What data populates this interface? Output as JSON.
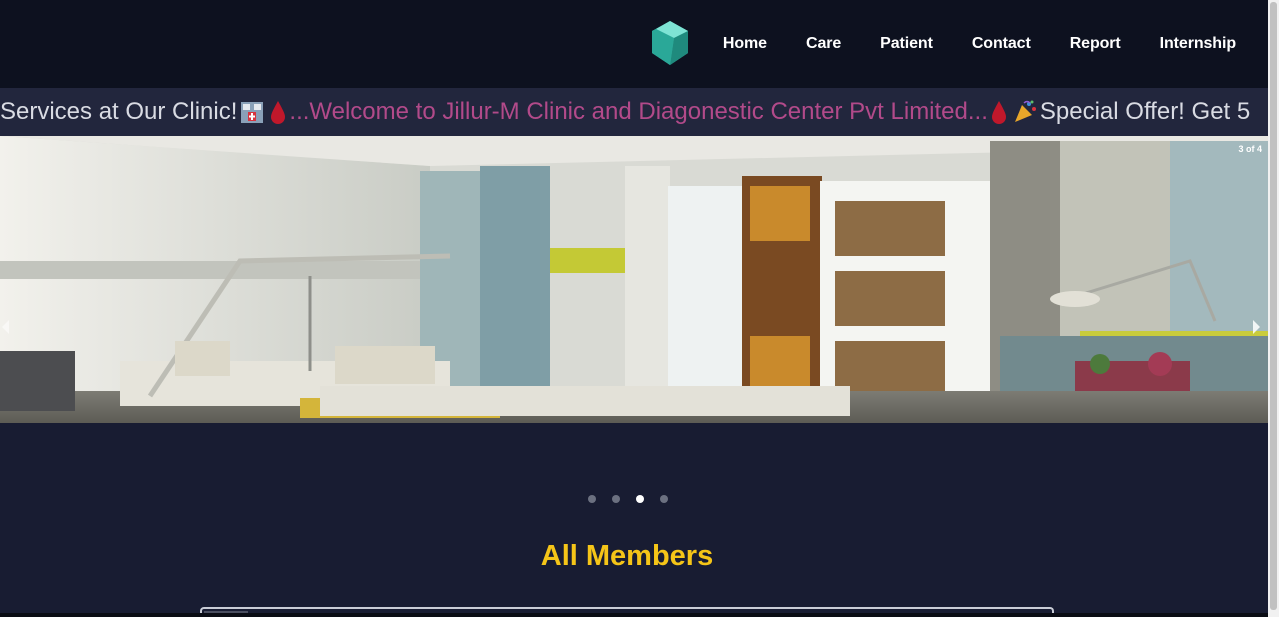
{
  "nav": {
    "logo": "gem-logo-icon",
    "links": [
      "Home",
      "Care",
      "Patient",
      "Contact",
      "Report",
      "Internship"
    ]
  },
  "marquee": {
    "part1": "Services at Our Clinic! ",
    "part2": "...Welcome to Jillur-M Clinic and Diagonestic Center Pvt Limited...",
    "part3": " Special Offer! Get 5"
  },
  "carousel": {
    "counter": "3 of 4",
    "slides": 4,
    "active_slide": 3
  },
  "section": {
    "heading": "All Members"
  },
  "colors": {
    "navbar": "#0d111f",
    "background": "#181c32",
    "heading": "#f5c518",
    "marquee_highlight": "#b24a8a"
  }
}
